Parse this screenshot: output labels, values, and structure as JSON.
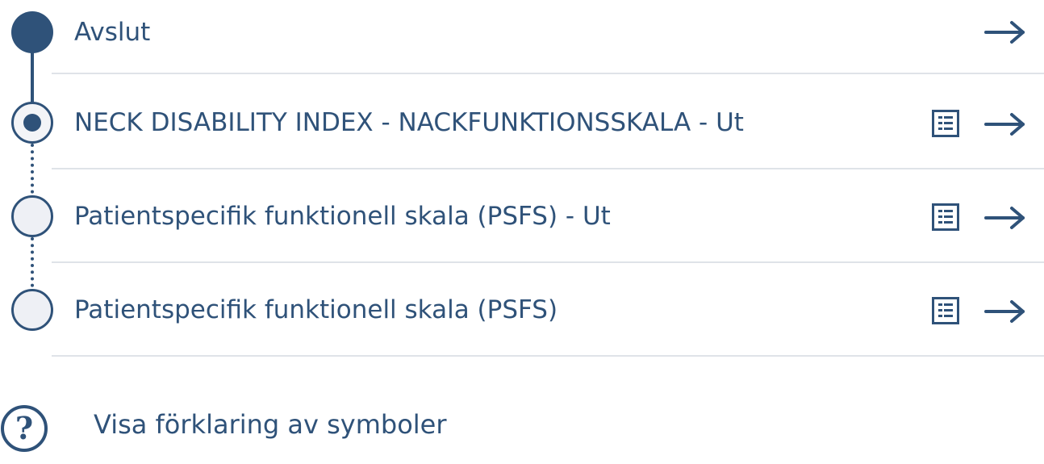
{
  "steps": [
    {
      "label": "Avslut",
      "status": "completed",
      "has_form_icon": false,
      "form_icon": "",
      "arrow_icon": "arrow-right"
    },
    {
      "label": "NECK DISABILITY INDEX - NACKFUNKTIONSSKALA - Ut",
      "status": "current",
      "has_form_icon": true,
      "form_icon": "form-list",
      "arrow_icon": "arrow-right"
    },
    {
      "label": "Patientspecifik funktionell skala (PSFS) - Ut",
      "status": "pending",
      "has_form_icon": true,
      "form_icon": "form-list",
      "arrow_icon": "arrow-right"
    },
    {
      "label": "Patientspecifik funktionell skala (PSFS)",
      "status": "pending",
      "has_form_icon": true,
      "form_icon": "form-list",
      "arrow_icon": "arrow-right"
    }
  ],
  "help": {
    "icon_glyph": "?",
    "icon": "question-circle",
    "label": "Visa förklaring av symboler"
  },
  "colors": {
    "primary": "#2f5279",
    "divider": "#dfe3e8",
    "node_fill": "#eef0f5"
  }
}
